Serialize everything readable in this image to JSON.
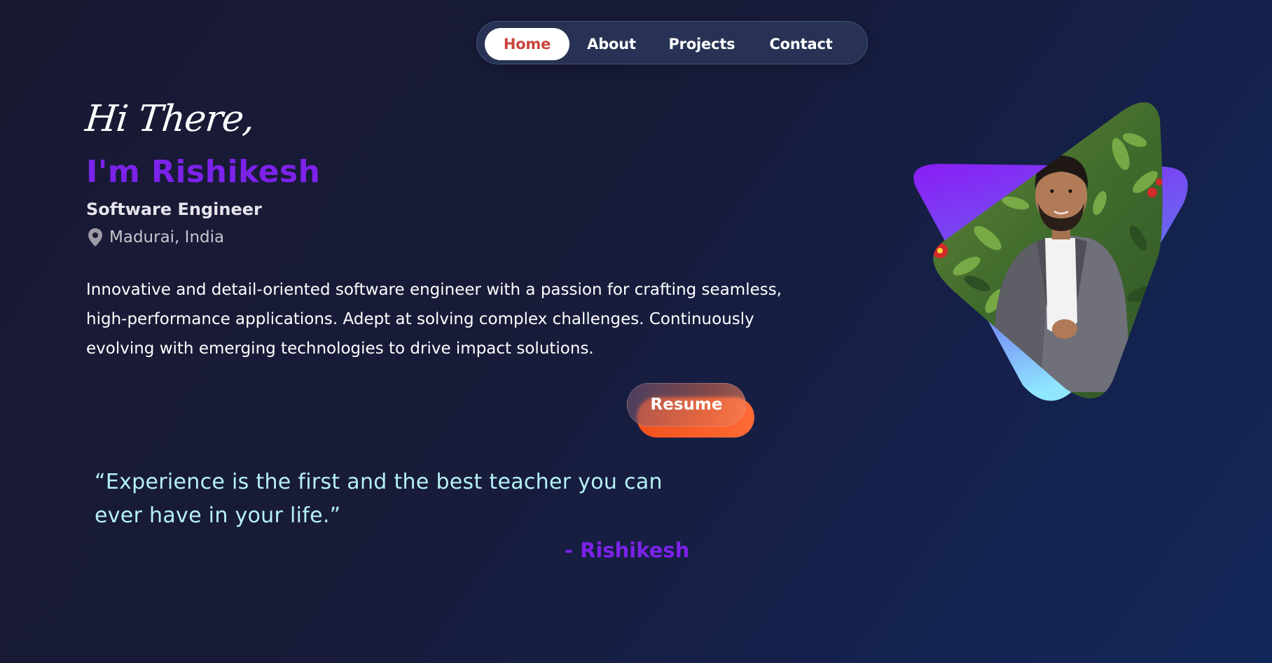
{
  "nav": {
    "items": [
      {
        "label": "Home",
        "active": true
      },
      {
        "label": "About",
        "active": false
      },
      {
        "label": "Projects",
        "active": false
      },
      {
        "label": "Contact",
        "active": false
      }
    ]
  },
  "hero": {
    "greeting": "Hi There,",
    "name": "I'm Rishikesh",
    "role": "Software Engineer",
    "location": "Madurai, India",
    "location_icon": "location-pin-icon",
    "description": "Innovative and detail-oriented software engineer with a passion for crafting seamless, high-performance applications. Adept at solving complex challenges. Continuously evolving with emerging technologies to drive impact solutions.",
    "resume_label": "Resume"
  },
  "quote": {
    "text": "“Experience is the first and the best teacher you can ever have in your life.”",
    "author": "- Rishikesh"
  },
  "colors": {
    "background": "#181a34",
    "accent_purple": "#7c22ea",
    "nav_active_text": "#c8453e",
    "resume_orange": "#f0521e",
    "quote_cyan": "#b5f2f5"
  }
}
